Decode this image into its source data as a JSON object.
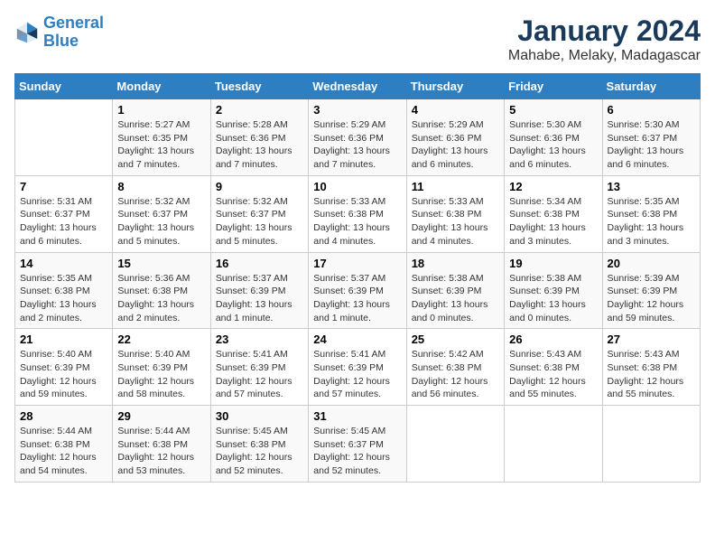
{
  "logo": {
    "line1": "General",
    "line2": "Blue"
  },
  "title": "January 2024",
  "subtitle": "Mahabe, Melaky, Madagascar",
  "days_of_week": [
    "Sunday",
    "Monday",
    "Tuesday",
    "Wednesday",
    "Thursday",
    "Friday",
    "Saturday"
  ],
  "weeks": [
    [
      {
        "day": "",
        "sunrise": "",
        "sunset": "",
        "daylight": ""
      },
      {
        "day": "1",
        "sunrise": "Sunrise: 5:27 AM",
        "sunset": "Sunset: 6:35 PM",
        "daylight": "Daylight: 13 hours and 7 minutes."
      },
      {
        "day": "2",
        "sunrise": "Sunrise: 5:28 AM",
        "sunset": "Sunset: 6:36 PM",
        "daylight": "Daylight: 13 hours and 7 minutes."
      },
      {
        "day": "3",
        "sunrise": "Sunrise: 5:29 AM",
        "sunset": "Sunset: 6:36 PM",
        "daylight": "Daylight: 13 hours and 7 minutes."
      },
      {
        "day": "4",
        "sunrise": "Sunrise: 5:29 AM",
        "sunset": "Sunset: 6:36 PM",
        "daylight": "Daylight: 13 hours and 6 minutes."
      },
      {
        "day": "5",
        "sunrise": "Sunrise: 5:30 AM",
        "sunset": "Sunset: 6:36 PM",
        "daylight": "Daylight: 13 hours and 6 minutes."
      },
      {
        "day": "6",
        "sunrise": "Sunrise: 5:30 AM",
        "sunset": "Sunset: 6:37 PM",
        "daylight": "Daylight: 13 hours and 6 minutes."
      }
    ],
    [
      {
        "day": "7",
        "sunrise": "Sunrise: 5:31 AM",
        "sunset": "Sunset: 6:37 PM",
        "daylight": "Daylight: 13 hours and 6 minutes."
      },
      {
        "day": "8",
        "sunrise": "Sunrise: 5:32 AM",
        "sunset": "Sunset: 6:37 PM",
        "daylight": "Daylight: 13 hours and 5 minutes."
      },
      {
        "day": "9",
        "sunrise": "Sunrise: 5:32 AM",
        "sunset": "Sunset: 6:37 PM",
        "daylight": "Daylight: 13 hours and 5 minutes."
      },
      {
        "day": "10",
        "sunrise": "Sunrise: 5:33 AM",
        "sunset": "Sunset: 6:38 PM",
        "daylight": "Daylight: 13 hours and 4 minutes."
      },
      {
        "day": "11",
        "sunrise": "Sunrise: 5:33 AM",
        "sunset": "Sunset: 6:38 PM",
        "daylight": "Daylight: 13 hours and 4 minutes."
      },
      {
        "day": "12",
        "sunrise": "Sunrise: 5:34 AM",
        "sunset": "Sunset: 6:38 PM",
        "daylight": "Daylight: 13 hours and 3 minutes."
      },
      {
        "day": "13",
        "sunrise": "Sunrise: 5:35 AM",
        "sunset": "Sunset: 6:38 PM",
        "daylight": "Daylight: 13 hours and 3 minutes."
      }
    ],
    [
      {
        "day": "14",
        "sunrise": "Sunrise: 5:35 AM",
        "sunset": "Sunset: 6:38 PM",
        "daylight": "Daylight: 13 hours and 2 minutes."
      },
      {
        "day": "15",
        "sunrise": "Sunrise: 5:36 AM",
        "sunset": "Sunset: 6:38 PM",
        "daylight": "Daylight: 13 hours and 2 minutes."
      },
      {
        "day": "16",
        "sunrise": "Sunrise: 5:37 AM",
        "sunset": "Sunset: 6:39 PM",
        "daylight": "Daylight: 13 hours and 1 minute."
      },
      {
        "day": "17",
        "sunrise": "Sunrise: 5:37 AM",
        "sunset": "Sunset: 6:39 PM",
        "daylight": "Daylight: 13 hours and 1 minute."
      },
      {
        "day": "18",
        "sunrise": "Sunrise: 5:38 AM",
        "sunset": "Sunset: 6:39 PM",
        "daylight": "Daylight: 13 hours and 0 minutes."
      },
      {
        "day": "19",
        "sunrise": "Sunrise: 5:38 AM",
        "sunset": "Sunset: 6:39 PM",
        "daylight": "Daylight: 13 hours and 0 minutes."
      },
      {
        "day": "20",
        "sunrise": "Sunrise: 5:39 AM",
        "sunset": "Sunset: 6:39 PM",
        "daylight": "Daylight: 12 hours and 59 minutes."
      }
    ],
    [
      {
        "day": "21",
        "sunrise": "Sunrise: 5:40 AM",
        "sunset": "Sunset: 6:39 PM",
        "daylight": "Daylight: 12 hours and 59 minutes."
      },
      {
        "day": "22",
        "sunrise": "Sunrise: 5:40 AM",
        "sunset": "Sunset: 6:39 PM",
        "daylight": "Daylight: 12 hours and 58 minutes."
      },
      {
        "day": "23",
        "sunrise": "Sunrise: 5:41 AM",
        "sunset": "Sunset: 6:39 PM",
        "daylight": "Daylight: 12 hours and 57 minutes."
      },
      {
        "day": "24",
        "sunrise": "Sunrise: 5:41 AM",
        "sunset": "Sunset: 6:39 PM",
        "daylight": "Daylight: 12 hours and 57 minutes."
      },
      {
        "day": "25",
        "sunrise": "Sunrise: 5:42 AM",
        "sunset": "Sunset: 6:38 PM",
        "daylight": "Daylight: 12 hours and 56 minutes."
      },
      {
        "day": "26",
        "sunrise": "Sunrise: 5:43 AM",
        "sunset": "Sunset: 6:38 PM",
        "daylight": "Daylight: 12 hours and 55 minutes."
      },
      {
        "day": "27",
        "sunrise": "Sunrise: 5:43 AM",
        "sunset": "Sunset: 6:38 PM",
        "daylight": "Daylight: 12 hours and 55 minutes."
      }
    ],
    [
      {
        "day": "28",
        "sunrise": "Sunrise: 5:44 AM",
        "sunset": "Sunset: 6:38 PM",
        "daylight": "Daylight: 12 hours and 54 minutes."
      },
      {
        "day": "29",
        "sunrise": "Sunrise: 5:44 AM",
        "sunset": "Sunset: 6:38 PM",
        "daylight": "Daylight: 12 hours and 53 minutes."
      },
      {
        "day": "30",
        "sunrise": "Sunrise: 5:45 AM",
        "sunset": "Sunset: 6:38 PM",
        "daylight": "Daylight: 12 hours and 52 minutes."
      },
      {
        "day": "31",
        "sunrise": "Sunrise: 5:45 AM",
        "sunset": "Sunset: 6:37 PM",
        "daylight": "Daylight: 12 hours and 52 minutes."
      },
      {
        "day": "",
        "sunrise": "",
        "sunset": "",
        "daylight": ""
      },
      {
        "day": "",
        "sunrise": "",
        "sunset": "",
        "daylight": ""
      },
      {
        "day": "",
        "sunrise": "",
        "sunset": "",
        "daylight": ""
      }
    ]
  ]
}
